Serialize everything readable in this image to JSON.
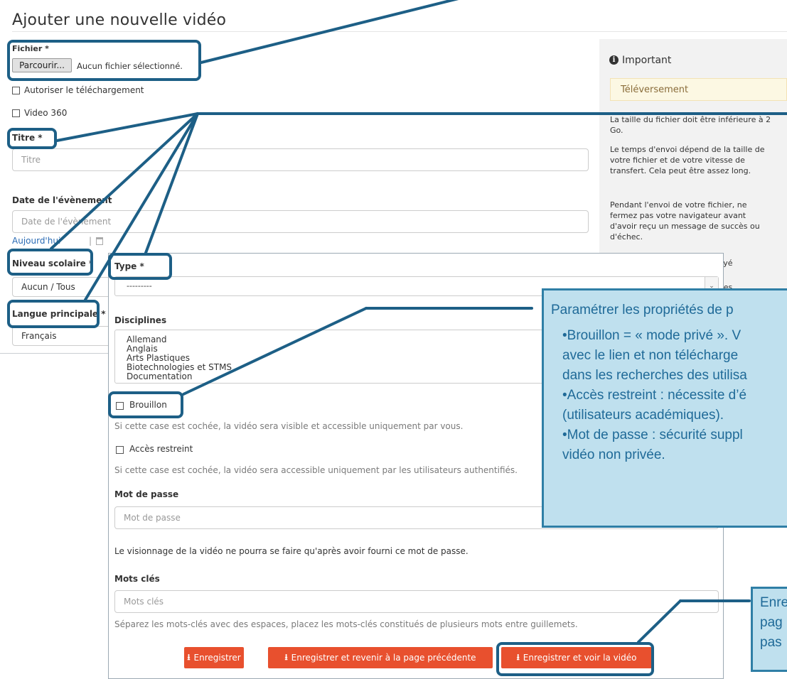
{
  "page": {
    "title": "Ajouter une nouvelle vidéo",
    "file": {
      "label": "Fichier *",
      "button": "Parcourir...",
      "status": "Aucun fichier sélectionné."
    },
    "allow_download": "Autoriser le téléchargement",
    "video360": "Video 360",
    "title_field": {
      "label": "Titre *",
      "placeholder": "Titre"
    },
    "event_date": {
      "label": "Date de l'évènement",
      "placeholder": "Date de l'évènement",
      "today": "Aujourd'hui",
      "separator": "|"
    },
    "school_level": {
      "label": "Niveau scolaire *",
      "value": "Aucun / Tous"
    },
    "main_language": {
      "label": "Langue principale *",
      "value": "Français"
    }
  },
  "side_panel": {
    "heading": "Important",
    "box": "Téléversement",
    "paragraphs": [
      "La taille du fichier doit être inférieure à 2 Go.",
      "Le temps d'envoi dépend de la taille de votre fichier et de votre vitesse de transfert. Cela peut être assez long.",
      "Pendant l'envoi de votre fichier, ne fermez pas votre navigateur avant d'avoir reçu un message de succès ou d'échec."
    ],
    "fragments": [
      "voyé",
      "s",
      "nées."
    ]
  },
  "form": {
    "type": {
      "label": "Type *",
      "value": "---------"
    },
    "disciplines": {
      "label": "Disciplines",
      "options": [
        "Allemand",
        "Anglais",
        "Arts Plastiques",
        "Biotechnologies et STMS",
        "Documentation"
      ]
    },
    "draft": {
      "label": "Brouillon",
      "help": "Si cette case est cochée, la vidéo sera visible et accessible uniquement par vous."
    },
    "restricted": {
      "label": "Accès restreint",
      "help": "Si cette case est cochée, la vidéo sera accessible uniquement par les utilisateurs authentifiés."
    },
    "password": {
      "label": "Mot de passe",
      "placeholder": "Mot de passe",
      "help": "Le visionnage de la vidéo ne pourra se faire qu'après avoir fourni ce mot de passe."
    },
    "keywords": {
      "label": "Mots clés",
      "placeholder": "Mots clés",
      "help": "Séparez les mots-clés avec des espaces, placez les mots-clés constitués de plusieurs mots entre guillemets."
    },
    "buttons": {
      "save": "Enregistrer",
      "save_back": "Enregistrer et revenir à la page précédente",
      "save_view": "Enregistrer et voir la vidéo",
      "icon": "⭳"
    }
  },
  "callouts": {
    "properties": {
      "lines": [
        "Paramétrer les propriétés de p",
        "•Brouillon = « mode privé ». V",
        "avec le lien et non télécharge",
        "dans les recherches des utilisa",
        "•Accès restreint : nécessite d’é",
        "(utilisateurs académiques).",
        "•Mot de passe : sécurité suppl",
        "vidéo non privée."
      ]
    },
    "save": {
      "lines": [
        "Enre",
        "pag",
        "pas"
      ]
    }
  },
  "colors": {
    "accent_button": "#e8502e",
    "callout_fill": "#bfe0ee",
    "callout_border": "#2f7fa6",
    "highlight": "#1d5f86"
  }
}
